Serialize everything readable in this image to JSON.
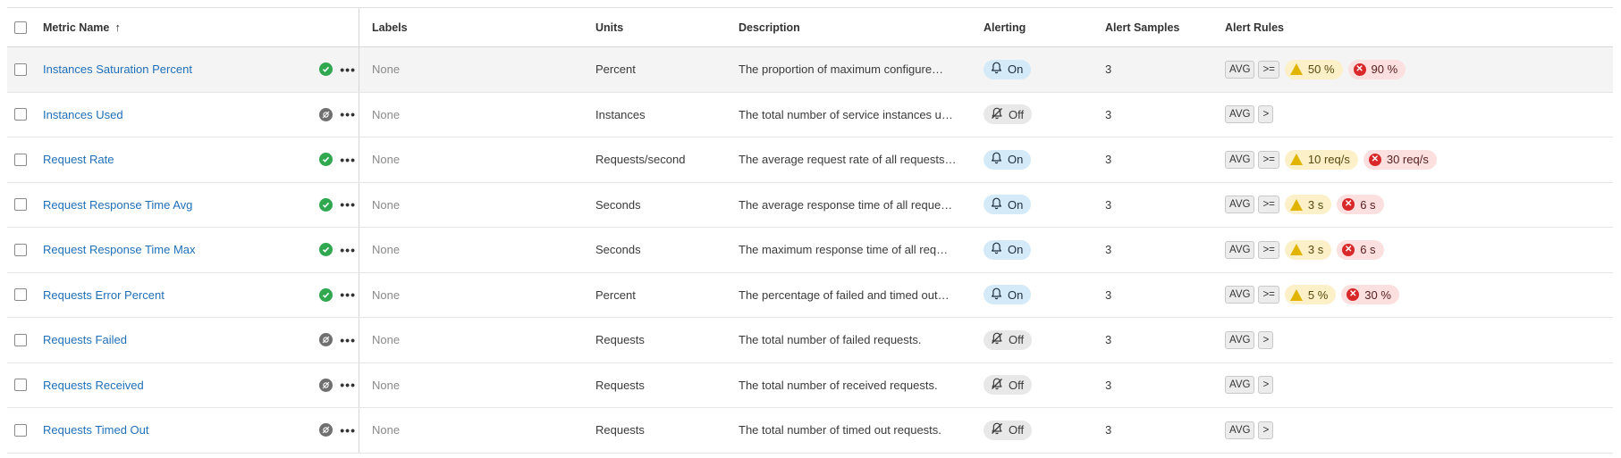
{
  "header": {
    "metric_name": "Metric Name",
    "sort_indicator": "↑",
    "labels": "Labels",
    "units": "Units",
    "description": "Description",
    "alerting": "Alerting",
    "alert_samples": "Alert Samples",
    "alert_rules": "Alert Rules"
  },
  "rows": [
    {
      "name": "Instances Saturation Percent",
      "status": "ok",
      "labels": "None",
      "units": "Percent",
      "description": "The proportion of maximum configure…",
      "alerting": "On",
      "samples": "3",
      "rule_avg": "AVG",
      "rule_op": ">=",
      "warn": "50 %",
      "crit": "90 %"
    },
    {
      "name": "Instances Used",
      "status": "off",
      "labels": "None",
      "units": "Instances",
      "description": "The total number of service instances u…",
      "alerting": "Off",
      "samples": "3",
      "rule_avg": "AVG",
      "rule_op": ">",
      "warn": "",
      "crit": ""
    },
    {
      "name": "Request Rate",
      "status": "ok",
      "labels": "None",
      "units": "Requests/second",
      "description": "The average request rate of all requests…",
      "alerting": "On",
      "samples": "3",
      "rule_avg": "AVG",
      "rule_op": ">=",
      "warn": "10 req/s",
      "crit": "30 req/s"
    },
    {
      "name": "Request Response Time Avg",
      "status": "ok",
      "labels": "None",
      "units": "Seconds",
      "description": "The average response time of all reque…",
      "alerting": "On",
      "samples": "3",
      "rule_avg": "AVG",
      "rule_op": ">=",
      "warn": "3 s",
      "crit": "6 s"
    },
    {
      "name": "Request Response Time Max",
      "status": "ok",
      "labels": "None",
      "units": "Seconds",
      "description": "The maximum response time of all req…",
      "alerting": "On",
      "samples": "3",
      "rule_avg": "AVG",
      "rule_op": ">=",
      "warn": "3 s",
      "crit": "6 s"
    },
    {
      "name": "Requests Error Percent",
      "status": "ok",
      "labels": "None",
      "units": "Percent",
      "description": "The percentage of failed and timed out…",
      "alerting": "On",
      "samples": "3",
      "rule_avg": "AVG",
      "rule_op": ">=",
      "warn": "5 %",
      "crit": "30 %"
    },
    {
      "name": "Requests Failed",
      "status": "off",
      "labels": "None",
      "units": "Requests",
      "description": "The total number of failed requests.",
      "alerting": "Off",
      "samples": "3",
      "rule_avg": "AVG",
      "rule_op": ">",
      "warn": "",
      "crit": ""
    },
    {
      "name": "Requests Received",
      "status": "off",
      "labels": "None",
      "units": "Requests",
      "description": "The total number of received requests.",
      "alerting": "Off",
      "samples": "3",
      "rule_avg": "AVG",
      "rule_op": ">",
      "warn": "",
      "crit": ""
    },
    {
      "name": "Requests Timed Out",
      "status": "off",
      "labels": "None",
      "units": "Requests",
      "description": "The total number of timed out requests.",
      "alerting": "Off",
      "samples": "3",
      "rule_avg": "AVG",
      "rule_op": ">",
      "warn": "",
      "crit": ""
    }
  ]
}
